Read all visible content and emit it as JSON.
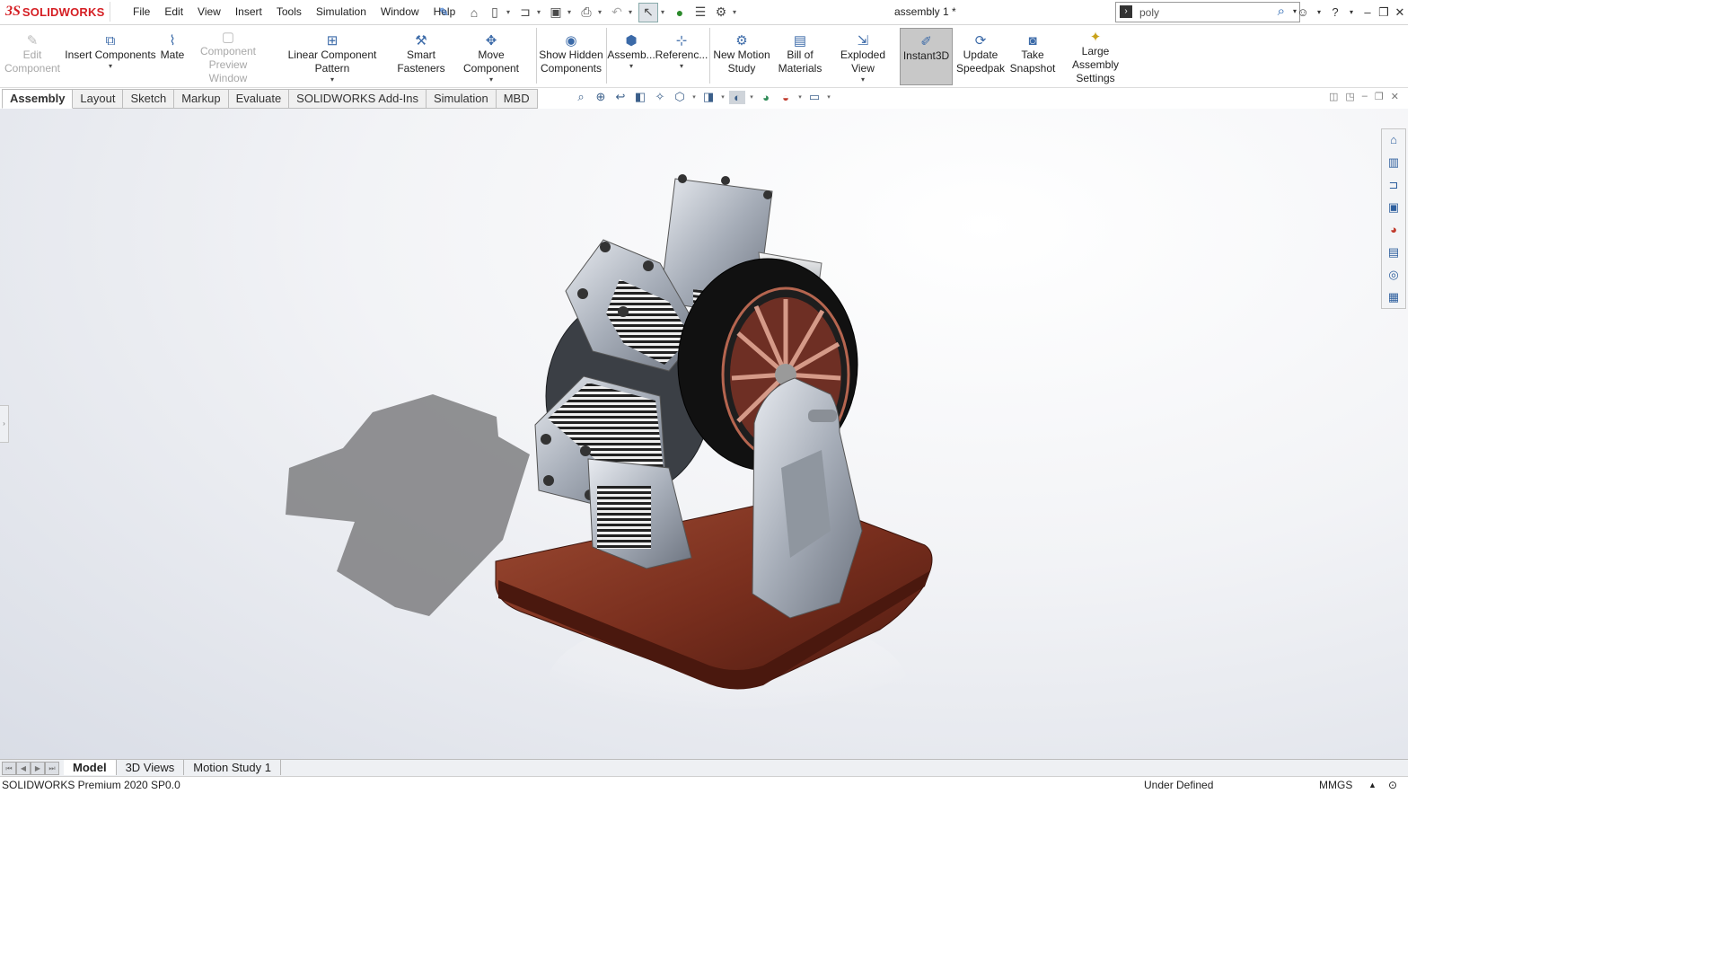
{
  "app": {
    "brand_mark": "3S",
    "brand_name": "SOLIDWORKS",
    "document_title": "assembly 1 *"
  },
  "menu": [
    "File",
    "Edit",
    "View",
    "Insert",
    "Tools",
    "Simulation",
    "Window",
    "Help"
  ],
  "search": {
    "value": "poly"
  },
  "command_manager": {
    "edit_component": "Edit Component",
    "insert_components": "Insert Components",
    "mate": "Mate",
    "component_preview_window": "Component Preview Window",
    "linear_component_pattern": "Linear Component Pattern",
    "smart_fasteners": "Smart Fasteners",
    "move_component": "Move Component",
    "show_hidden_components": "Show Hidden Components",
    "assembly_features": "Assemb...",
    "reference_geometry": "Referenc...",
    "new_motion_study": "New Motion Study",
    "bill_of_materials": "Bill of Materials",
    "exploded_view": "Exploded View",
    "instant3d": "Instant3D",
    "update_speedpak": "Update Speedpak",
    "take_snapshot": "Take Snapshot",
    "large_assembly_settings": "Large Assembly Settings"
  },
  "tabs": [
    {
      "label": "Assembly",
      "active": true
    },
    {
      "label": "Layout"
    },
    {
      "label": "Sketch"
    },
    {
      "label": "Markup"
    },
    {
      "label": "Evaluate"
    },
    {
      "label": "SOLIDWORKS Add-Ins"
    },
    {
      "label": "Simulation"
    },
    {
      "label": "MBD"
    }
  ],
  "bottom_tabs": [
    {
      "label": "Model",
      "active": true
    },
    {
      "label": "3D Views"
    },
    {
      "label": "Motion Study 1"
    }
  ],
  "status": {
    "product": "SOLIDWORKS Premium 2020 SP0.0",
    "state": "Under Defined",
    "units": "MMGS"
  },
  "colors": {
    "brand_red": "#d51e23",
    "wood_base": "#7a2f1e",
    "flywheel": "#1a1a1a",
    "copper_spokes": "#b5654f",
    "cylinder_steel": "#a6adb8"
  }
}
